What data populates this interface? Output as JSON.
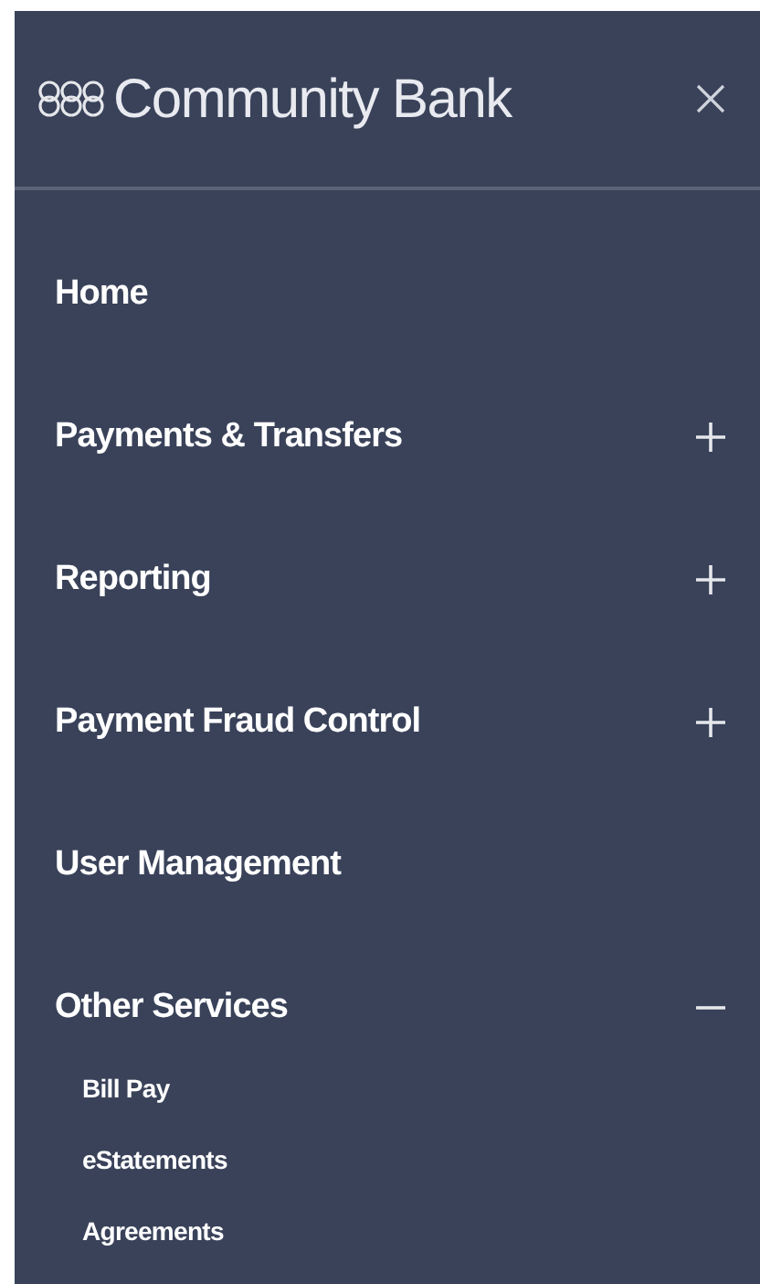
{
  "header": {
    "title": "Community Bank"
  },
  "menu": [
    {
      "label": "Home"
    },
    {
      "label": "Payments & Transfers",
      "expanded": false
    },
    {
      "label": "Reporting",
      "expanded": false
    },
    {
      "label": "Payment Fraud Control",
      "expanded": false
    },
    {
      "label": "User Management"
    },
    {
      "label": "Other Services",
      "expanded": true,
      "children": [
        {
          "label": "Bill Pay"
        },
        {
          "label": "eStatements"
        },
        {
          "label": "Agreements"
        }
      ]
    }
  ]
}
